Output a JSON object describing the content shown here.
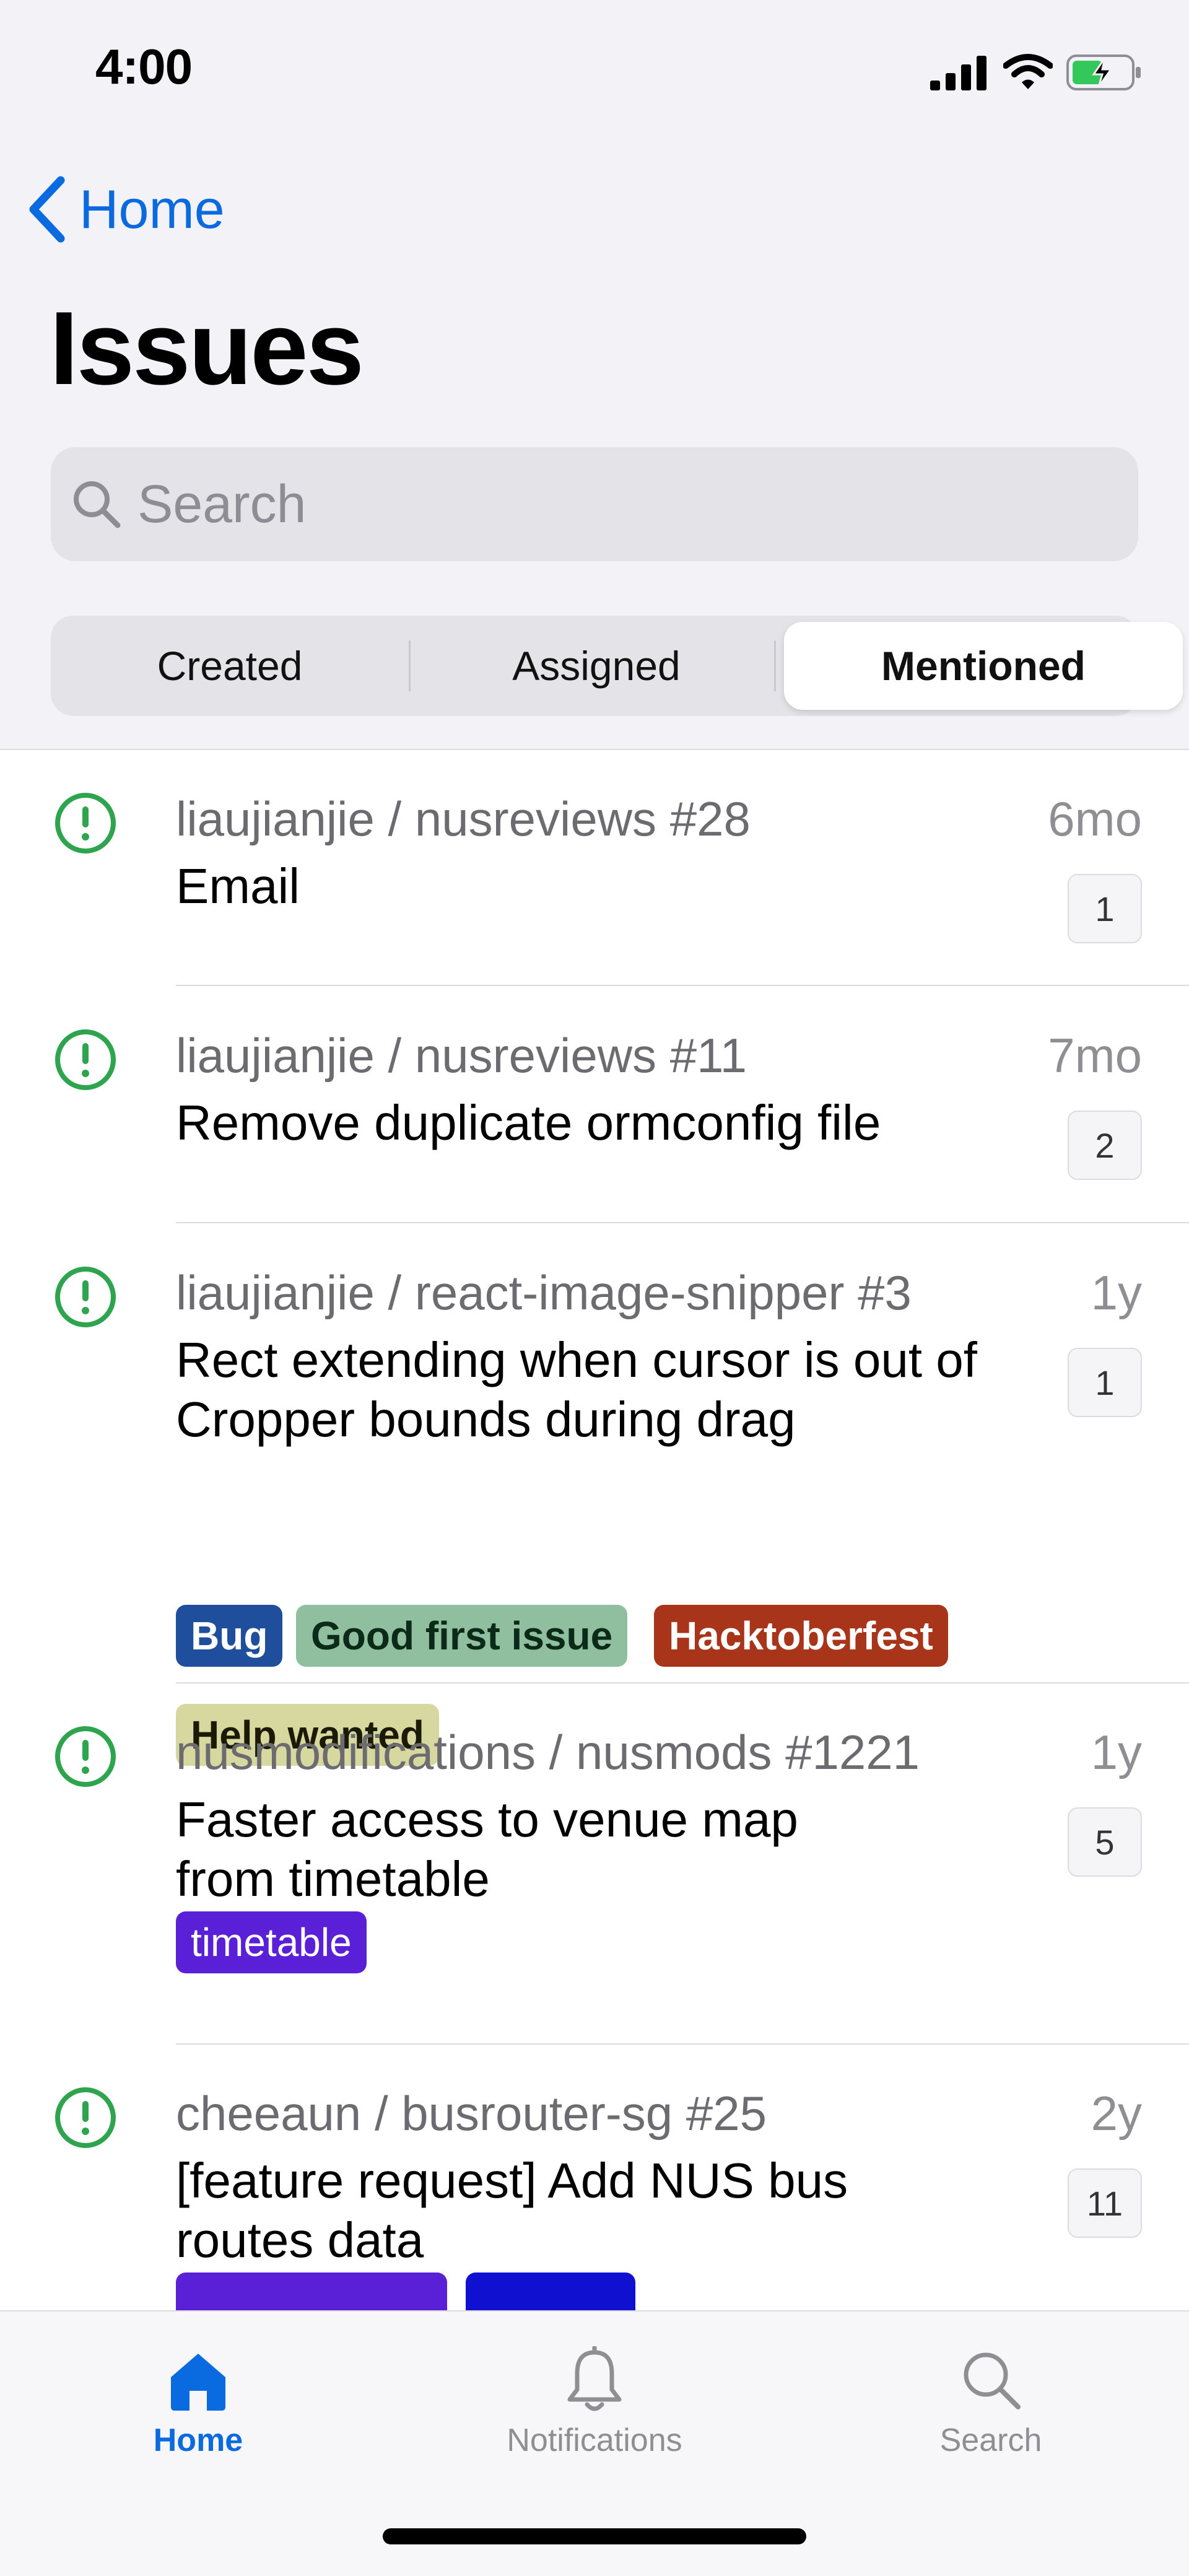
{
  "status_bar": {
    "time": "4:00"
  },
  "nav": {
    "back_label": "Home",
    "title": "Issues"
  },
  "search": {
    "placeholder": "Search"
  },
  "segments": [
    {
      "label": "Created",
      "selected": false
    },
    {
      "label": "Assigned",
      "selected": false
    },
    {
      "label": "Mentioned",
      "selected": true
    }
  ],
  "issues": [
    {
      "repo": "liaujianjie / nusreviews #28",
      "age": "6mo",
      "title_lines": [
        "Email"
      ],
      "comments": "1",
      "labels": []
    },
    {
      "repo": "liaujianjie / nusreviews #11",
      "age": "7mo",
      "title_lines": [
        "Remove duplicate ormconfig file"
      ],
      "comments": "2",
      "labels": []
    },
    {
      "repo": "liaujianjie / react-image-snipper #3",
      "age": "1y",
      "title_lines": [
        "Rect extending when cursor is out of",
        "Cropper bounds during drag"
      ],
      "comments": "1",
      "labels": [
        {
          "text": "Bug",
          "bg": "#1f4f9c",
          "fg": "#ffffff"
        },
        {
          "text": "Good first issue",
          "bg": "#8fbf9f",
          "fg": "#0b2a17"
        },
        {
          "text": "Hacktoberfest",
          "bg": "#a8341a",
          "fg": "#ffffff"
        },
        {
          "text": "Help wanted",
          "bg": "#d6d8a0",
          "fg": "#1b1b05"
        }
      ]
    },
    {
      "repo": "nusmodifications / nusmods #1221",
      "age": "1y",
      "title_lines": [
        "Faster access to venue map",
        "from timetable"
      ],
      "comments": "5",
      "labels": [
        {
          "text": "timetable",
          "bg": "#5a20d8",
          "fg": "#ffffff"
        }
      ]
    },
    {
      "repo": "cheeaun / busrouter-sg #25",
      "age": "2y",
      "title_lines": [
        "[feature request] Add NUS bus",
        "routes data"
      ],
      "comments": "11",
      "labels": [
        {
          "text": "",
          "bg": "#5a20d8",
          "fg": "#ffffff"
        },
        {
          "text": "",
          "bg": "#1010d0",
          "fg": "#ffffff"
        }
      ]
    }
  ],
  "tab_bar": {
    "tabs": [
      {
        "label": "Home",
        "icon": "home-icon",
        "active": true
      },
      {
        "label": "Notifications",
        "icon": "bell-icon",
        "active": false
      },
      {
        "label": "Search",
        "icon": "search-icon",
        "active": false
      }
    ],
    "active_color": "#0a6ae0",
    "inactive_color": "#8e8e93"
  },
  "colors": {
    "accent": "#0a6ae0",
    "open_issue": "#2ea44f",
    "battery": "#34c759"
  }
}
